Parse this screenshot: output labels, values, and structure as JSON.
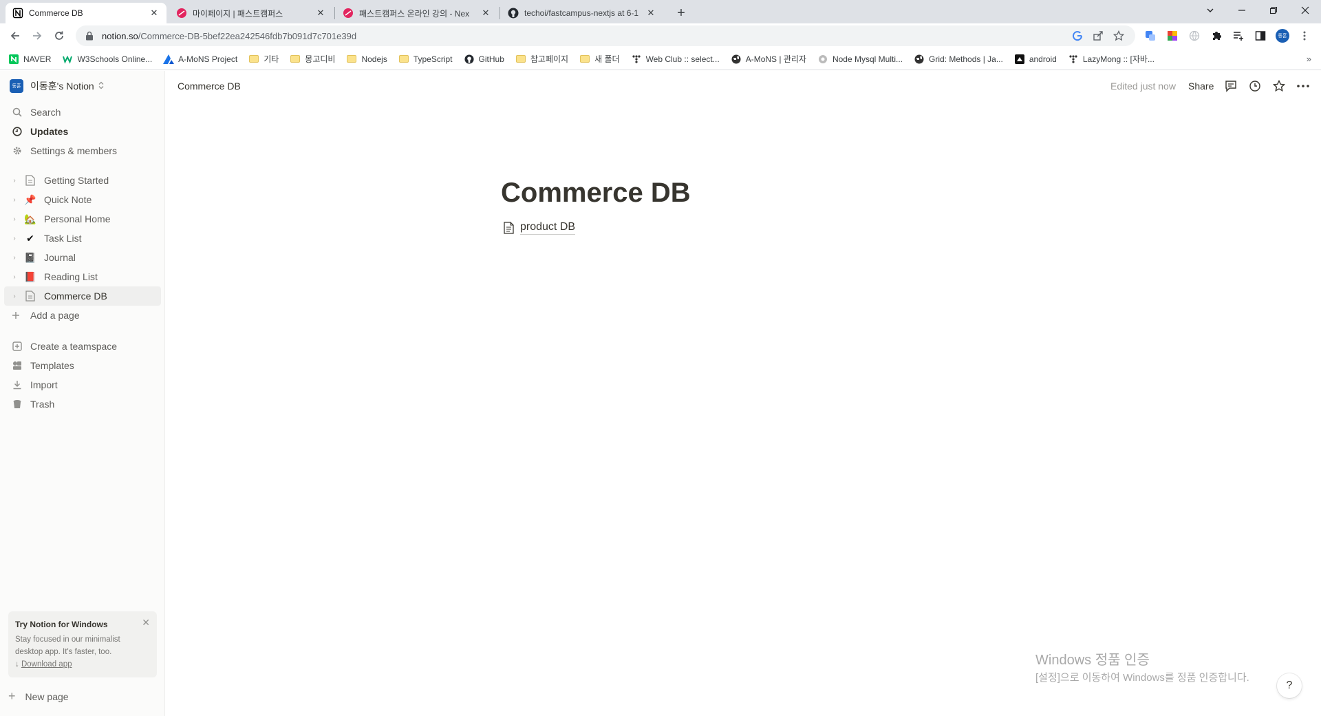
{
  "browser": {
    "tabs": [
      {
        "title": "Commerce DB",
        "active": true
      },
      {
        "title": "마이페이지 | 패스트캠퍼스",
        "active": false
      },
      {
        "title": "패스트캠퍼스 온라인 강의 - Nex",
        "active": false
      },
      {
        "title": "techoi/fastcampus-nextjs at 6-1",
        "active": false
      }
    ],
    "url_domain": "notion.so",
    "url_path": "/Commerce-DB-5bef22ea242546fdb7b091d7c701e39d",
    "bookmarks": [
      {
        "label": "NAVER",
        "icon": "naver-icon"
      },
      {
        "label": "W3Schools Online...",
        "icon": "w3schools-icon"
      },
      {
        "label": "A-MoNS Project",
        "icon": "amons-icon"
      },
      {
        "label": "기타",
        "icon": "folder-icon"
      },
      {
        "label": "몽고디비",
        "icon": "folder-icon"
      },
      {
        "label": "Nodejs",
        "icon": "folder-icon"
      },
      {
        "label": "TypeScript",
        "icon": "folder-icon"
      },
      {
        "label": "GitHub",
        "icon": "github-icon"
      },
      {
        "label": "참고페이지",
        "icon": "folder-icon"
      },
      {
        "label": "새 폴더",
        "icon": "folder-icon"
      },
      {
        "label": "Web Club :: select...",
        "icon": "webclub-icon"
      },
      {
        "label": "A-MoNS | 관리자",
        "icon": "globe-icon"
      },
      {
        "label": "Node Mysql Multi...",
        "icon": "gear-icon"
      },
      {
        "label": "Grid: Methods | Ja...",
        "icon": "globe-icon"
      },
      {
        "label": "android",
        "icon": "android-icon"
      },
      {
        "label": "LazyMong :: [자바...",
        "icon": "lazymong-icon"
      }
    ],
    "profile_initials": "동훈"
  },
  "sidebar": {
    "workspace": "이동훈's Notion",
    "workspace_avatar": "동훈",
    "top_items": [
      {
        "label": "Search",
        "icon": "search-icon"
      },
      {
        "label": "Updates",
        "icon": "clock-icon"
      },
      {
        "label": "Settings & members",
        "icon": "gear-icon"
      }
    ],
    "pages": [
      {
        "label": "Getting Started",
        "emoji": "📄"
      },
      {
        "label": "Quick Note",
        "emoji": "📌"
      },
      {
        "label": "Personal Home",
        "emoji": "🏡"
      },
      {
        "label": "Task List",
        "emoji": "✔"
      },
      {
        "label": "Journal",
        "emoji": "📓"
      },
      {
        "label": "Reading List",
        "emoji": "📕"
      },
      {
        "label": "Commerce DB",
        "emoji": "📄",
        "selected": true
      }
    ],
    "add_page": "Add a page",
    "bottom_items": [
      {
        "label": "Create a teamspace",
        "icon": "teamspace-icon"
      },
      {
        "label": "Templates",
        "icon": "templates-icon"
      },
      {
        "label": "Import",
        "icon": "import-icon"
      },
      {
        "label": "Trash",
        "icon": "trash-icon"
      }
    ],
    "promo": {
      "title": "Try Notion for Windows",
      "text": "Stay focused in our minimalist desktop app. It's faster, too.",
      "link": "Download app"
    },
    "new_page": "New page"
  },
  "topbar": {
    "breadcrumb": "Commerce DB",
    "edited": "Edited just now",
    "share": "Share"
  },
  "page": {
    "title": "Commerce DB",
    "subpage": "product DB"
  },
  "watermark": {
    "line1": "Windows 정품 인증",
    "line2": "[설정]으로 이동하여 Windows를 정품 인증합니다."
  },
  "help": "?"
}
